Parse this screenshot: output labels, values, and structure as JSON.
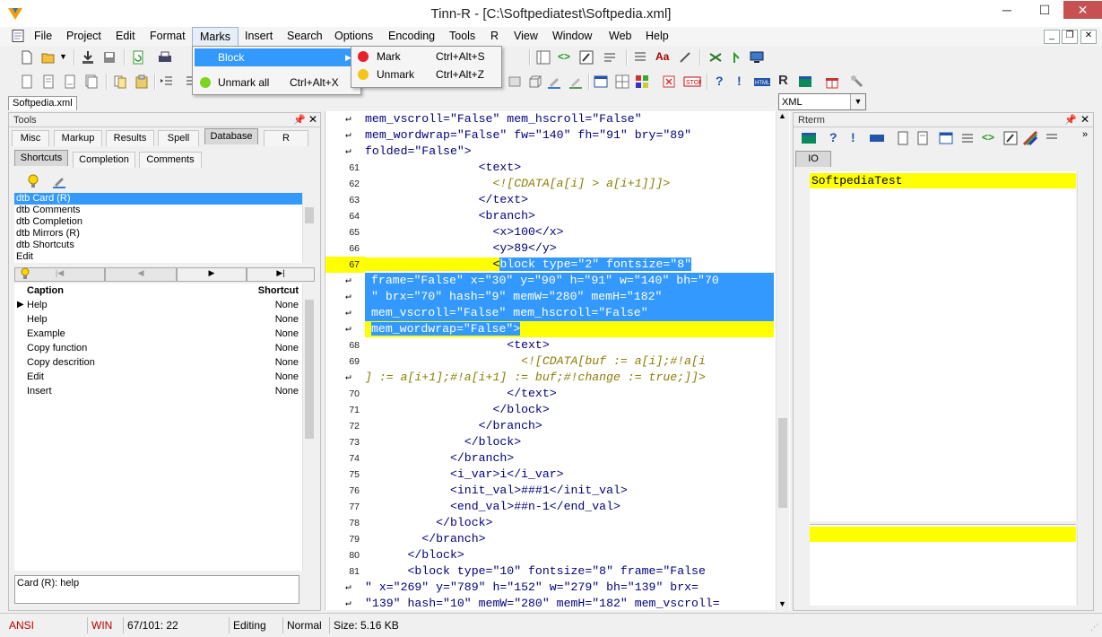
{
  "window": {
    "title": "Tinn-R - [C:\\Softpediatest\\Softpedia.xml]",
    "minimize": "─",
    "maximize": "☐",
    "close": "✕"
  },
  "menubar": {
    "items": [
      "File",
      "Project",
      "Edit",
      "Format",
      "Marks",
      "Insert",
      "Search",
      "Options",
      "Encoding",
      "Tools",
      "R",
      "View",
      "Window",
      "Web",
      "Help"
    ]
  },
  "marks_menu": {
    "block_label": "Block",
    "unmark_all_label": "Unmark all",
    "unmark_all_shortcut": "Ctrl+Alt+X"
  },
  "block_menu": {
    "mark_label": "Mark",
    "mark_shortcut": "Ctrl+Alt+S",
    "unmark_label": "Unmark",
    "unmark_shortcut": "Ctrl+Alt+Z"
  },
  "toolbar": {
    "syntax_select": "XML"
  },
  "file_tab": "Softpedia.xml",
  "tools_panel": {
    "title": "Tools",
    "tabs": [
      "Misc",
      "Markup",
      "Results",
      "Spell",
      "Database",
      "R"
    ],
    "selected_tab": "Database",
    "subtabs": [
      "Shortcuts",
      "Completion",
      "Comments"
    ],
    "shortcut_items": [
      "dtb Card (R)",
      "dtb Comments",
      "dtb Completion",
      "dtb Mirrors (R)",
      "dtb Shortcuts",
      "Edit"
    ],
    "grid_header": {
      "caption": "Caption",
      "shortcut": "Shortcut"
    },
    "grid_rows": [
      {
        "caption": "Help",
        "shortcut": "None"
      },
      {
        "caption": "Help",
        "shortcut": "None"
      },
      {
        "caption": "Example",
        "shortcut": "None"
      },
      {
        "caption": "Copy function",
        "shortcut": "None"
      },
      {
        "caption": "Copy descrition",
        "shortcut": "None"
      },
      {
        "caption": "Edit",
        "shortcut": "None"
      },
      {
        "caption": "Insert",
        "shortcut": "None"
      }
    ],
    "help_text": "Card (R): help"
  },
  "editor": {
    "lines": [
      {
        "ln": "",
        "wrap": true,
        "code": "mem_vscroll=\"False\" mem_hscroll=\"False\""
      },
      {
        "ln": "",
        "wrap": true,
        "code": "mem_wordwrap=\"False\" fw=\"140\" fh=\"91\" bry=\"89\""
      },
      {
        "ln": "",
        "wrap": true,
        "code": "folded=\"False\">"
      },
      {
        "ln": "61",
        "wrap": false,
        "code": "                <text>"
      },
      {
        "ln": "62",
        "wrap": false,
        "code": "                  <![CDATA[a[i] > a[i+1]]]>",
        "cdata": true
      },
      {
        "ln": "63",
        "wrap": false,
        "code": "                </text>"
      },
      {
        "ln": "64",
        "wrap": false,
        "code": "                <branch>"
      },
      {
        "ln": "65",
        "wrap": false,
        "code": "                  <x>100</x>"
      },
      {
        "ln": "66",
        "wrap": false,
        "code": "                  <y>89</y>"
      },
      {
        "ln": "67",
        "wrap": false,
        "code": "                  <block type=\"2\" fontsize=\"8\"",
        "hl": "first"
      },
      {
        "ln": "",
        "wrap": true,
        "code": "frame=\"False\" x=\"30\" y=\"90\" h=\"91\" w=\"140\" bh=\"70",
        "hl": "sel"
      },
      {
        "ln": "",
        "wrap": true,
        "code": "\" brx=\"70\" hash=\"9\" memW=\"280\" memH=\"182\"",
        "hl": "sel"
      },
      {
        "ln": "",
        "wrap": true,
        "code": "mem_vscroll=\"False\" mem_hscroll=\"False\"",
        "hl": "sel"
      },
      {
        "ln": "",
        "wrap": true,
        "code": "mem_wordwrap=\"False\">",
        "hl": "last"
      },
      {
        "ln": "68",
        "wrap": false,
        "code": "                    <text>"
      },
      {
        "ln": "69",
        "wrap": false,
        "code": "                      <![CDATA[buf := a[i];#!a[i",
        "cdata": true
      },
      {
        "ln": "",
        "wrap": true,
        "code": "] := a[i+1];#!a[i+1] := buf;#!change := true;]]>",
        "cdata": true
      },
      {
        "ln": "70",
        "wrap": false,
        "code": "                    </text>"
      },
      {
        "ln": "71",
        "wrap": false,
        "code": "                  </block>"
      },
      {
        "ln": "72",
        "wrap": false,
        "code": "                </branch>"
      },
      {
        "ln": "73",
        "wrap": false,
        "code": "              </block>"
      },
      {
        "ln": "74",
        "wrap": false,
        "code": "            </branch>"
      },
      {
        "ln": "75",
        "wrap": false,
        "code": "            <i_var>i</i_var>"
      },
      {
        "ln": "76",
        "wrap": false,
        "code": "            <init_val>###1</init_val>"
      },
      {
        "ln": "77",
        "wrap": false,
        "code": "            <end_val>##n-1</end_val>"
      },
      {
        "ln": "78",
        "wrap": false,
        "code": "          </block>"
      },
      {
        "ln": "79",
        "wrap": false,
        "code": "        </branch>"
      },
      {
        "ln": "80",
        "wrap": false,
        "code": "      </block>"
      },
      {
        "ln": "81",
        "wrap": false,
        "code": "      <block type=\"10\" fontsize=\"8\" frame=\"False"
      },
      {
        "ln": "",
        "wrap": true,
        "code": "\" x=\"269\" y=\"789\" h=\"152\" w=\"279\" bh=\"139\" brx="
      },
      {
        "ln": "",
        "wrap": true,
        "code": "\"139\" hash=\"10\" memW=\"280\" memH=\"182\" mem_vscroll="
      }
    ]
  },
  "rterm": {
    "title": "Rterm",
    "io_tab": "IO",
    "output": "SoftpediaTest"
  },
  "statusbar": {
    "encoding": "ANSI",
    "line_endings": "WIN",
    "position": "67/101: 22",
    "mode": "Editing",
    "state": "Normal",
    "size": "Size: 5.16 KB"
  },
  "colors": {
    "selection": "#3399ff",
    "highlight": "#ffff00",
    "tag": "#000080",
    "cdata": "#8b7d00",
    "status_red": "#c00000"
  }
}
